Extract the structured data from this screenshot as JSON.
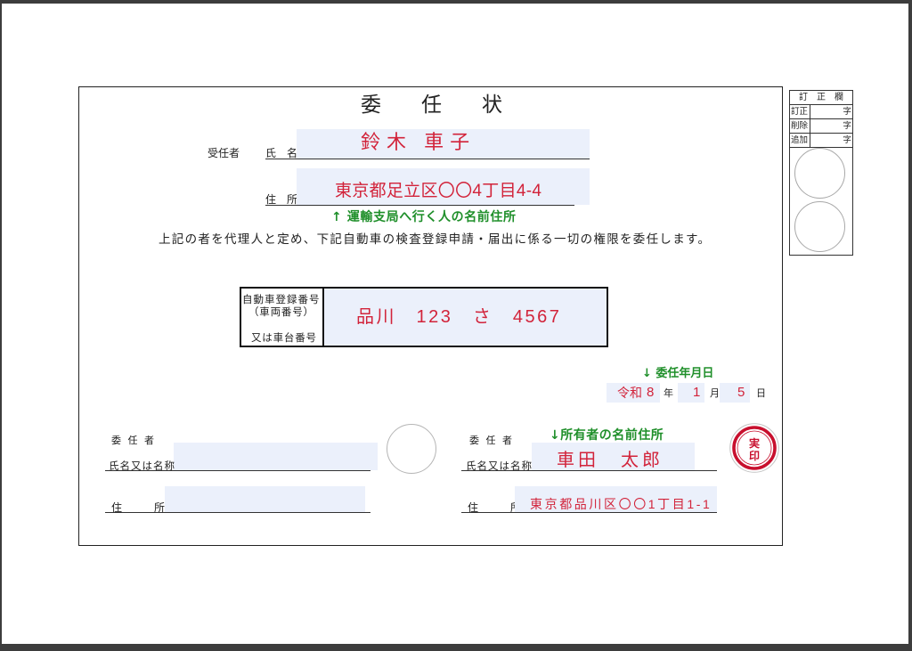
{
  "form": {
    "title": "委　任　状",
    "proxy": {
      "section_label": "受任者",
      "name_label": "氏　名",
      "name_value": "鈴木 車子",
      "address_label": "住　所",
      "address_value": "東京都足立区〇〇4丁目4-4",
      "note": "↑ 運輸支局へ行く人の名前住所"
    },
    "statement": "上記の者を代理人と定め、下記自動車の検査登録申請・届出に係る一切の権限を委任します。",
    "vehicle": {
      "label_lines": [
        "自動車登録番号",
        "（車両番号）",
        "又は車台番号"
      ],
      "value": "品川　123　さ　4567"
    },
    "date": {
      "note": "↓ 委任年月日",
      "era": "令和",
      "year": "8",
      "year_unit": "年",
      "month": "1",
      "month_unit": "月",
      "day": "5",
      "day_unit": "日"
    },
    "delegator_left": {
      "section_label": "委 任 者",
      "name_label": "氏名又は名称",
      "address_label": "住　　所"
    },
    "delegator_right": {
      "section_label": "委 任 者",
      "note": "↓所有者の名前住所",
      "name_label": "氏名又は名称",
      "name_value": "車田　太郎",
      "address_label": "住　　所",
      "address_value": "東京都品川区〇〇1丁目1-1",
      "seal": [
        "実",
        "印"
      ]
    }
  },
  "correction_box": {
    "title": "訂　正　欄",
    "rows": [
      {
        "label": "訂正",
        "unit": "字"
      },
      {
        "label": "削除",
        "unit": "字"
      },
      {
        "label": "追加",
        "unit": "字"
      }
    ]
  },
  "icons": {
    "owner_seal": "jitsuin-seal-icon",
    "seal_placeholder": "seal-placeholder-circle-icon"
  },
  "colors": {
    "filled_text": "#d2233a",
    "note_text": "#1f8f2a",
    "field_background": "#ebf0fb",
    "label_text": "#222222",
    "seal": "#c8102e"
  }
}
